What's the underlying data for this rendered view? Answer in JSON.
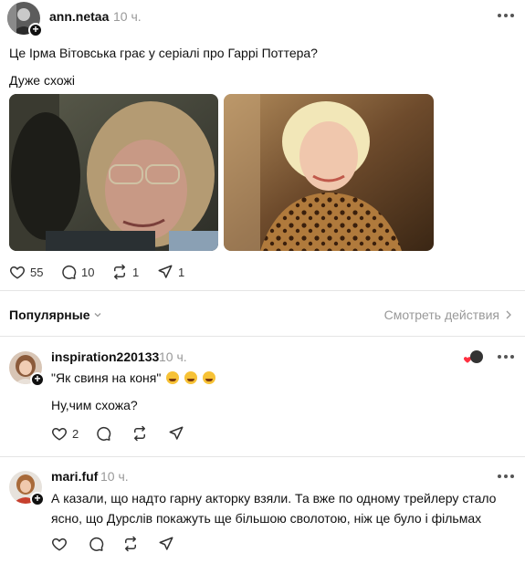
{
  "post": {
    "username": "ann.netaa",
    "time": "10 ч.",
    "text": "Це Ірма Вітовська грає у серіалі про Гаррі Поттера?",
    "caption": "Дуже схожі",
    "likes": "55",
    "comments": "10",
    "reposts": "1",
    "shares": "1"
  },
  "sort": {
    "label": "Популярные",
    "activity_link": "Смотреть действия"
  },
  "replies": [
    {
      "username": "inspiration220133",
      "time": "10 ч.",
      "line1": "\"Як свиня на коня\"",
      "line2": "Ну,чим схожа?",
      "likes": "2"
    },
    {
      "username": "mari.fuf",
      "time": "10 ч.",
      "text": "А казали, що надто гарну акторку взяли. Та вже по одному трейлеру стало ясно, що Дурслів покажуть ще більшою сволотою, ніж це було і фільмах"
    }
  ],
  "icons": {
    "like": "heart-icon",
    "comment": "comment-bubble-icon",
    "repost": "repost-icon",
    "share": "send-icon",
    "more": "more-dots-icon",
    "chevron_down": "chevron-down-icon",
    "chevron_right": "chevron-right-icon"
  },
  "colors": {
    "text": "#101010",
    "muted": "#999999",
    "divider": "#e5e5e5",
    "like_red": "#ff3040"
  }
}
